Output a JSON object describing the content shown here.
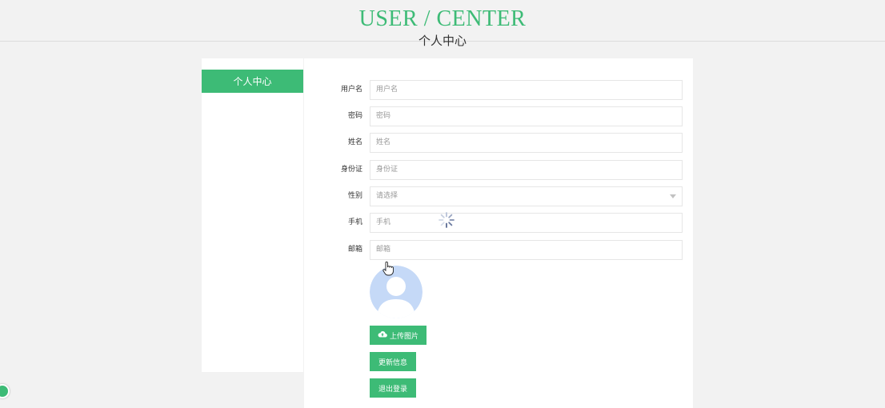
{
  "header": {
    "title_en": "USER / CENTER",
    "title_cn": "个人中心"
  },
  "sidebar": {
    "items": [
      {
        "label": "个人中心",
        "active": true
      }
    ]
  },
  "form": {
    "username": {
      "label": "用户名",
      "placeholder": "用户名",
      "value": ""
    },
    "password": {
      "label": "密码",
      "placeholder": "密码",
      "value": ""
    },
    "name": {
      "label": "姓名",
      "placeholder": "姓名",
      "value": ""
    },
    "id_card": {
      "label": "身份证",
      "placeholder": "身份证",
      "value": ""
    },
    "gender": {
      "label": "性别",
      "placeholder": "请选择",
      "value": ""
    },
    "phone": {
      "label": "手机",
      "placeholder": "手机",
      "value": ""
    },
    "email": {
      "label": "邮箱",
      "placeholder": "邮箱",
      "value": ""
    }
  },
  "actions": {
    "upload_label": "上传图片",
    "update_label": "更新信息",
    "logout_label": "退出登录"
  },
  "icons": {
    "avatar": "default-user-avatar",
    "upload": "cloud-upload-icon",
    "select": "chevron-down-icon",
    "loading": "loading-spinner-icon",
    "cursor": "hand-pointer-cursor"
  },
  "colors": {
    "accent": "#3dbb76",
    "background": "#f2f2f2",
    "avatar": "#c5d9f7"
  }
}
